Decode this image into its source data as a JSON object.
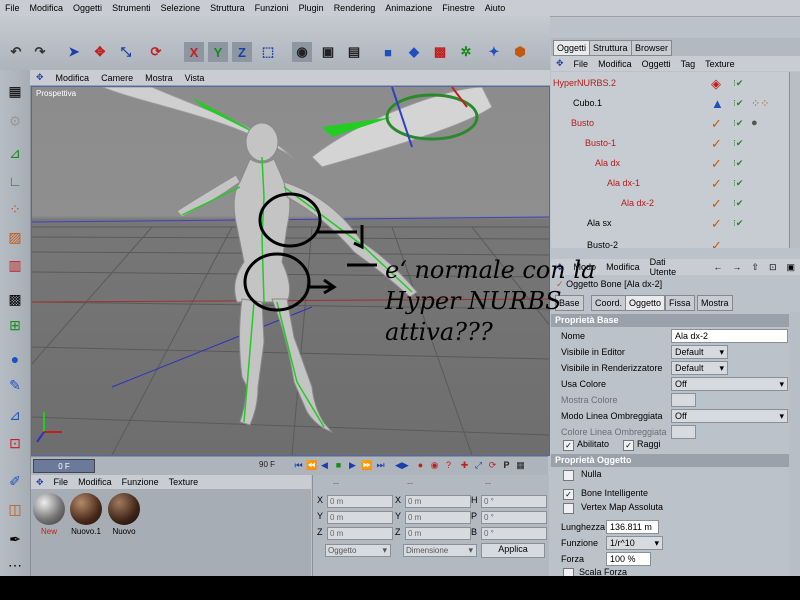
{
  "menubar": [
    "File",
    "Modifica",
    "Oggetti",
    "Strumenti",
    "Selezione",
    "Struttura",
    "Funzioni",
    "Plugin",
    "Rendering",
    "Animazione",
    "Finestre",
    "Aiuto"
  ],
  "toolbar_icons": [
    "undo-icon",
    "redo-icon",
    "pointer-icon",
    "move-icon",
    "scale-icon",
    "rotate-icon",
    "x-axis-icon",
    "y-axis-icon",
    "z-axis-icon",
    "world-coords-icon",
    "render-view-icon",
    "render-picture-icon",
    "render-settings-icon",
    "cube-icon",
    "nurbs-icon",
    "deformer-icon",
    "scene-icon",
    "light-icon",
    "camera-icon"
  ],
  "viewport": {
    "menu": [
      "Modifica",
      "Camere",
      "Mostra",
      "Vista"
    ],
    "label": "Prospettiva"
  },
  "timeline": {
    "current_frame": "0 F",
    "end_frame": "90 F"
  },
  "materials": {
    "menu": [
      "File",
      "Modifica",
      "Funzione",
      "Texture"
    ],
    "items": [
      "New",
      "Nuovo.1",
      "Nuovo"
    ]
  },
  "coords": {
    "headers": [
      "--",
      "--",
      "--"
    ],
    "rows": [
      {
        "axis": "X",
        "pos": "0 m",
        "size": "0 m",
        "rot_axis": "H",
        "rot": "0 °"
      },
      {
        "axis": "Y",
        "pos": "0 m",
        "size": "0 m",
        "rot_axis": "P",
        "rot": "0 °"
      },
      {
        "axis": "Z",
        "pos": "0 m",
        "size": "0 m",
        "rot_axis": "B",
        "rot": "0 °"
      }
    ],
    "mode": "Oggetto",
    "size_mode": "Dimensione",
    "apply": "Applica"
  },
  "objtabs": [
    "Oggetti",
    "Struttura",
    "Browser"
  ],
  "objmenu": [
    "File",
    "Modifica",
    "Oggetti",
    "Tag",
    "Texture"
  ],
  "objects": [
    {
      "name": "HyperNURBS.2",
      "indent": 0
    },
    {
      "name": "Cubo.1",
      "indent": 1
    },
    {
      "name": "Busto",
      "indent": 1
    },
    {
      "name": "Busto-1",
      "indent": 2
    },
    {
      "name": "Ala dx",
      "indent": 3
    },
    {
      "name": "Ala dx-1",
      "indent": 4
    },
    {
      "name": "Ala dx-2",
      "indent": 5
    },
    {
      "name": "Ala sx",
      "indent": 3
    },
    {
      "name": "Busto-2",
      "indent": 3
    }
  ],
  "attributes": {
    "menu": [
      "Modo",
      "Modifica",
      "Dati Utente"
    ],
    "title": "Oggetto Bone [Ala dx-2]",
    "tabs": [
      "Base",
      "Coord.",
      "Oggetto",
      "Fissa",
      "Mostra"
    ],
    "section_base": "Proprietà Base",
    "nome_label": "Nome",
    "nome_value": "Ala dx-2",
    "vis_editor_label": "Visibile in Editor",
    "vis_editor_value": "Default",
    "vis_render_label": "Visibile in Renderizzatore",
    "vis_render_value": "Default",
    "usa_colore_label": "Usa Colore",
    "usa_colore_value": "Off",
    "mostra_colore_label": "Mostra Colore",
    "modo_linea_label": "Modo Linea Ombreggiata",
    "modo_linea_value": "Off",
    "colore_linea_label": "Colore Linea Ombreggiata",
    "abilitato": "Abilitato",
    "raggi": "Raggi",
    "section_obj": "Proprietà Oggetto",
    "nulla": "Nulla",
    "bone_intel": "Bone Intelligente",
    "vertex_map": "Vertex Map Assoluta",
    "lunghezza_label": "Lunghezza",
    "lunghezza_value": "136.811 m",
    "funzione_label": "Funzione",
    "funzione_value": "1/r^10",
    "forza_label": "Forza",
    "forza_value": "100 %",
    "scala_forza": "Scala Forza"
  },
  "annotation": [
    "e‘ normale con la",
    "Hyper NURBS",
    "attiva???"
  ],
  "colors": {
    "accent_red": "#b41c1c",
    "bone_green": "#22cc22",
    "viewport_bg": "#8c8c8c"
  }
}
